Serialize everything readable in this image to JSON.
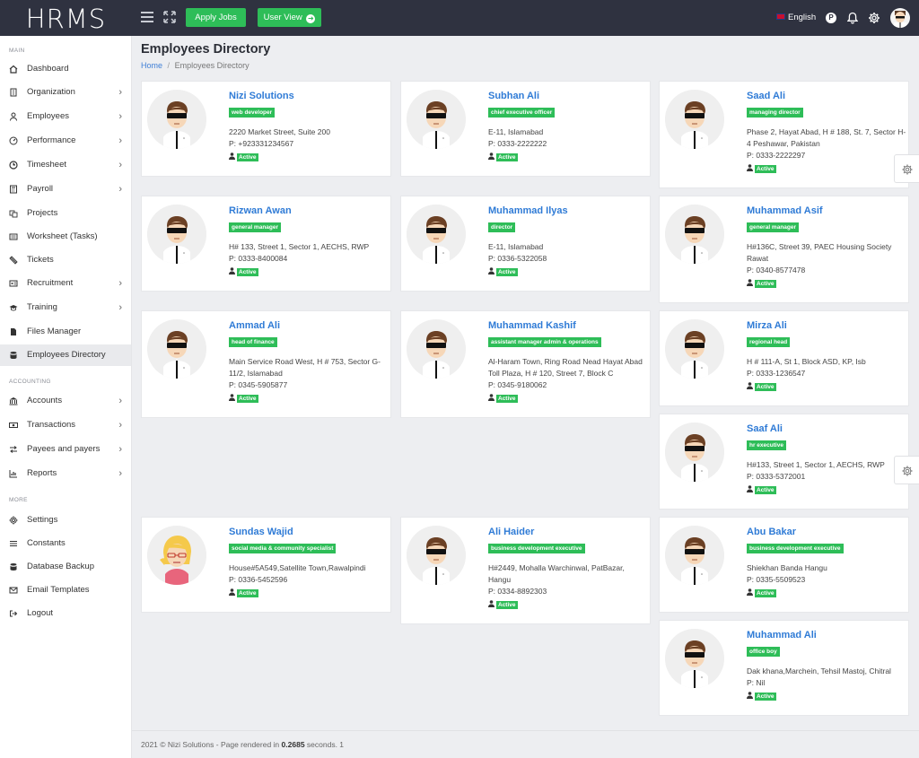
{
  "app": {
    "logo": "HRMS"
  },
  "header": {
    "apply_jobs": "Apply Jobs",
    "user_view": "User View",
    "language": "English",
    "p_badge": "P"
  },
  "sidebar": {
    "sections": [
      "MAIN",
      "ACCOUNTING",
      "MORE"
    ],
    "items": [
      {
        "label": "Dashboard",
        "icon": "home-icon",
        "chevron": false
      },
      {
        "label": "Organization",
        "icon": "building-icon",
        "chevron": true
      },
      {
        "label": "Employees",
        "icon": "user-icon",
        "chevron": true
      },
      {
        "label": "Performance",
        "icon": "dashboard-icon",
        "chevron": true
      },
      {
        "label": "Timesheet",
        "icon": "clock-icon",
        "chevron": true
      },
      {
        "label": "Payroll",
        "icon": "calculator-icon",
        "chevron": true
      },
      {
        "label": "Projects",
        "icon": "projects-icon",
        "chevron": false
      },
      {
        "label": "Worksheet (Tasks)",
        "icon": "tasks-icon",
        "chevron": false
      },
      {
        "label": "Tickets",
        "icon": "ticket-icon",
        "chevron": false
      },
      {
        "label": "Recruitment",
        "icon": "id-card-icon",
        "chevron": true
      },
      {
        "label": "Training",
        "icon": "graduation-cap-icon",
        "chevron": true
      },
      {
        "label": "Files Manager",
        "icon": "file-icon",
        "chevron": false
      },
      {
        "label": "Employees Directory",
        "icon": "database-icon",
        "chevron": false,
        "active": true
      },
      {
        "label": "Accounts",
        "icon": "bank-icon",
        "chevron": true
      },
      {
        "label": "Transactions",
        "icon": "money-icon",
        "chevron": true
      },
      {
        "label": "Payees and payers",
        "icon": "exchange-icon",
        "chevron": true
      },
      {
        "label": "Reports",
        "icon": "bar-chart-icon",
        "chevron": true
      },
      {
        "label": "Settings",
        "icon": "gear-icon",
        "chevron": false
      },
      {
        "label": "Constants",
        "icon": "list-icon",
        "chevron": false
      },
      {
        "label": "Database Backup",
        "icon": "database-icon",
        "chevron": false
      },
      {
        "label": "Email Templates",
        "icon": "envelope-icon",
        "chevron": false
      },
      {
        "label": "Logout",
        "icon": "logout-icon",
        "chevron": false
      }
    ]
  },
  "page": {
    "title": "Employees Directory",
    "breadcrumb_home": "Home",
    "breadcrumb_sep": "/",
    "breadcrumb_current": "Employees Directory"
  },
  "employees": [
    {
      "name": "Nizi Solutions",
      "role": "web developer",
      "address": "2220 Market Street, Suite 200",
      "phone": "P: +923331234567",
      "status": "Active",
      "gender": "male"
    },
    {
      "name": "Subhan Ali",
      "role": "chief executive officer",
      "address": "E-11, Islamabad",
      "phone": "P: 0333-2222222",
      "status": "Active",
      "gender": "male"
    },
    {
      "name": "Saad Ali",
      "role": "managing director",
      "address": "Phase 2, Hayat Abad, H # 188, St. 7, Sector H-4 Peshawar, Pakistan",
      "phone": "P: 0333-2222297",
      "status": "Active",
      "gender": "male"
    },
    {
      "name": "Rizwan Awan",
      "role": "general manager",
      "address": "H# 133, Street 1, Sector 1, AECHS, RWP",
      "phone": "P: 0333-8400084",
      "status": "Active",
      "gender": "male"
    },
    {
      "name": "Muhammad Ilyas",
      "role": "director",
      "address": "E-11, Islamabad",
      "phone": "P: 0336-5322058",
      "status": "Active",
      "gender": "male"
    },
    {
      "name": "Muhammad Asif",
      "role": "general manager",
      "address": "H#136C, Street 39, PAEC Housing Society Rawat",
      "phone": "P: 0340-8577478",
      "status": "Active",
      "gender": "male"
    },
    {
      "name": "Ammad Ali",
      "role": "head of finance",
      "address": "Main Service Road West, H # 753, Sector G-11/2, Islamabad",
      "phone": "P: 0345-5905877",
      "status": "Active",
      "gender": "male"
    },
    {
      "name": "Muhammad Kashif",
      "role": "assistant manager admin & operations",
      "address": "Al-Haram Town, Ring Road Nead Hayat Abad Toll Plaza, H # 120, Street 7, Block C",
      "phone": "P: 0345-9180062",
      "status": "Active",
      "gender": "male"
    },
    {
      "name": "Mirza Ali",
      "role": "regional head",
      "address": "H # 111-A, St 1, Block ASD, KP, Isb",
      "phone": "P: 0333-1236547",
      "status": "Active",
      "gender": "male"
    },
    {
      "name": "Saaf Ali",
      "role": "hr executive",
      "address": "H#133, Street 1, Sector 1, AECHS, RWP",
      "phone": "P: 0333-5372001",
      "status": "Active",
      "gender": "male"
    },
    {
      "name": "Sundas Wajid",
      "role": "social media & community specialist",
      "address": "House#5A549,Satellite Town,Rawalpindi",
      "phone": "P: 0336-5452596",
      "status": "Active",
      "gender": "female"
    },
    {
      "name": "Ali Haider",
      "role": "business development executive",
      "address": "H#2449, Mohalla Warchinwal, PatBazar, Hangu",
      "phone": "P: 0334-8892303",
      "status": "Active",
      "gender": "male"
    },
    {
      "name": "Abu Bakar",
      "role": "business development executive",
      "address": "Shiekhan Banda Hangu",
      "phone": "P: 0335-5509523",
      "status": "Active",
      "gender": "male"
    },
    {
      "name": "Muhammad Ali",
      "role": "office boy",
      "address": "Dak khana,Marchein, Tehsil Mastoj, Chitral",
      "phone": "P: Nil",
      "status": "Active",
      "gender": "male"
    }
  ],
  "footer": {
    "text": "2021 © Nizi Solutions - Page rendered in",
    "time": "0.2685",
    "suffix": "seconds. 1"
  },
  "colors": {
    "accent_green": "#2ebd58",
    "topbar": "#2f3240",
    "link_blue": "#2f7bd6"
  }
}
